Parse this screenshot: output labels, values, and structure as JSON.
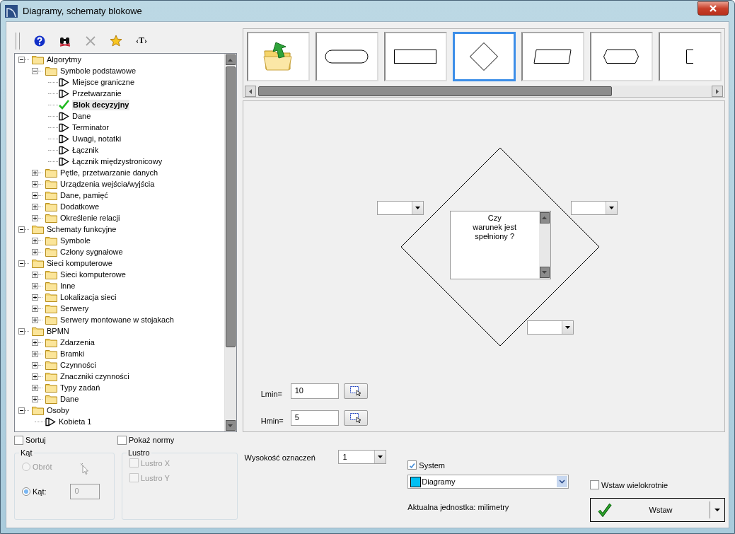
{
  "window": {
    "title": "Diagramy, schematy blokowe"
  },
  "toolbar": [
    {
      "kind": "help",
      "disabled": false
    },
    {
      "kind": "binoculars",
      "disabled": false
    },
    {
      "kind": "delete",
      "disabled": true
    },
    {
      "kind": "star",
      "disabled": false
    },
    {
      "kind": "text",
      "label": "‹T›",
      "disabled": false
    }
  ],
  "tree": [
    {
      "kind": "folder",
      "label": "Algorytmy",
      "expanded": true,
      "selected": false,
      "children": [
        {
          "kind": "folder",
          "label": "Symbole podstawowe",
          "expanded": true,
          "selected": false,
          "children": [
            {
              "kind": "symbol",
              "label": "Miejsce graniczne",
              "selected": false
            },
            {
              "kind": "symbol",
              "label": "Przetwarzanie",
              "selected": false
            },
            {
              "kind": "symbol",
              "label": "Blok decyzyjny",
              "selected": true
            },
            {
              "kind": "symbol",
              "label": "Dane",
              "selected": false
            },
            {
              "kind": "symbol",
              "label": "Terminator",
              "selected": false
            },
            {
              "kind": "symbol",
              "label": "Uwagi, notatki",
              "selected": false
            },
            {
              "kind": "symbol",
              "label": "Łącznik",
              "selected": false
            },
            {
              "kind": "symbol",
              "label": "Łącznik międzystronicowy",
              "selected": false
            }
          ]
        },
        {
          "kind": "folder",
          "label": "Pętle, przetwarzanie danych",
          "expanded": false,
          "selected": false
        },
        {
          "kind": "folder",
          "label": "Urządzenia wejścia/wyjścia",
          "expanded": false,
          "selected": false
        },
        {
          "kind": "folder",
          "label": "Dane, pamięć",
          "expanded": false,
          "selected": false
        },
        {
          "kind": "folder",
          "label": "Dodatkowe",
          "expanded": false,
          "selected": false
        },
        {
          "kind": "folder",
          "label": "Określenie relacji",
          "expanded": false,
          "selected": false
        }
      ]
    },
    {
      "kind": "folder",
      "label": "Schematy funkcyjne",
      "expanded": true,
      "selected": false,
      "children": [
        {
          "kind": "folder",
          "label": "Symbole",
          "expanded": false,
          "selected": false
        },
        {
          "kind": "folder",
          "label": "Człony sygnałowe",
          "expanded": false,
          "selected": false
        }
      ]
    },
    {
      "kind": "folder",
      "label": "Sieci komputerowe",
      "expanded": true,
      "selected": false,
      "children": [
        {
          "kind": "folder",
          "label": "Sieci komputerowe",
          "expanded": false,
          "selected": false
        },
        {
          "kind": "folder",
          "label": "Inne",
          "expanded": false,
          "selected": false
        },
        {
          "kind": "folder",
          "label": "Lokalizacja sieci",
          "expanded": false,
          "selected": false
        },
        {
          "kind": "folder",
          "label": "Serwery",
          "expanded": false,
          "selected": false
        },
        {
          "kind": "folder",
          "label": "Serwery montowane w stojakach",
          "expanded": false,
          "selected": false
        }
      ]
    },
    {
      "kind": "folder",
      "label": "BPMN",
      "expanded": true,
      "selected": false,
      "children": [
        {
          "kind": "folder",
          "label": "Zdarzenia",
          "expanded": false,
          "selected": false
        },
        {
          "kind": "folder",
          "label": "Bramki",
          "expanded": false,
          "selected": false
        },
        {
          "kind": "folder",
          "label": "Czynności",
          "expanded": false,
          "selected": false
        },
        {
          "kind": "folder",
          "label": "Znaczniki czynności",
          "expanded": false,
          "selected": false
        },
        {
          "kind": "folder",
          "label": "Typy zadań",
          "expanded": false,
          "selected": false
        },
        {
          "kind": "folder",
          "label": "Dane",
          "expanded": false,
          "selected": false
        }
      ]
    },
    {
      "kind": "folder",
      "label": "Osoby",
      "expanded": true,
      "selected": false,
      "children": [
        {
          "kind": "symbol",
          "label": "Kobieta 1",
          "selected": false
        }
      ]
    }
  ],
  "gallery": [
    {
      "kind": "folder",
      "selected": false
    },
    {
      "kind": "terminator",
      "selected": false
    },
    {
      "kind": "rectangle",
      "selected": false
    },
    {
      "kind": "diamond",
      "selected": true
    },
    {
      "kind": "parallelogram",
      "selected": false
    },
    {
      "kind": "hexagon",
      "selected": false
    },
    {
      "kind": "bracket",
      "selected": false
    }
  ],
  "canvas": {
    "text": "Czy\nwarunek jest\nspełniony ?"
  },
  "lmin": {
    "label": "Lmin=",
    "value": "10"
  },
  "hmin": {
    "label": "Hmin=",
    "value": "5"
  },
  "sort": {
    "label": "Sortuj",
    "checked": false
  },
  "show_norms": {
    "label": "Pokaż normy",
    "checked": false
  },
  "angle_group": {
    "title": "Kąt",
    "field": {
      "value": "0",
      "disabled": true
    },
    "options": [
      {
        "label": "Obrót",
        "selected": false,
        "disabled": true
      },
      {
        "label": "Kąt:",
        "selected": true,
        "disabled": false
      }
    ]
  },
  "mirror_group": {
    "title": "Lustro",
    "options": [
      {
        "label": "Lustro X",
        "checked": false,
        "disabled": true
      },
      {
        "label": "Lustro Y",
        "checked": false,
        "disabled": true
      }
    ]
  },
  "label_height": {
    "label": "Wysokość oznaczeń",
    "value": "1"
  },
  "system": {
    "label": "System",
    "checked": true
  },
  "layer": {
    "value": "Diagramy",
    "color": "#00bff3"
  },
  "unit_text": "Aktualna jednostka: milimetry",
  "insert_multiple": {
    "label": "Wstaw wielokrotnie",
    "checked": false
  },
  "insert_button": {
    "label": "Wstaw"
  }
}
